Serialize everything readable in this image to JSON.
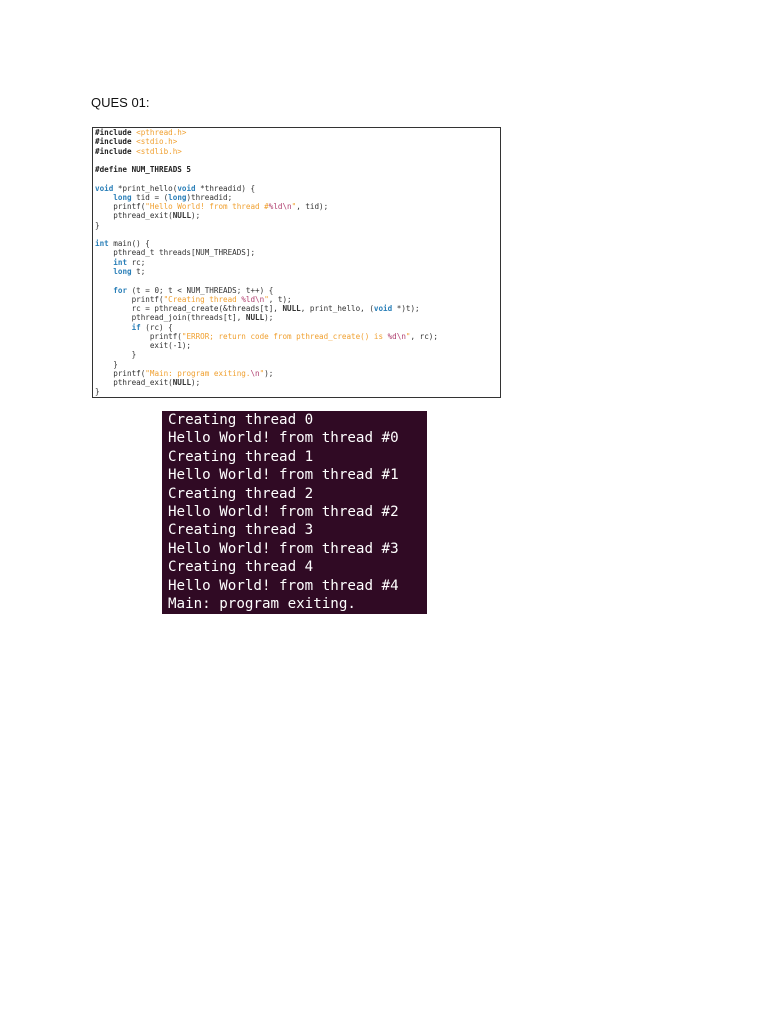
{
  "heading": "QUES 01:",
  "code_lines": [
    [
      [
        "#include ",
        "pp"
      ],
      [
        "<pthread.h>",
        "str"
      ]
    ],
    [
      [
        "#include ",
        "pp"
      ],
      [
        "<stdio.h>",
        "str"
      ]
    ],
    [
      [
        "#include ",
        "pp"
      ],
      [
        "<stdlib.h>",
        "str"
      ]
    ],
    [
      [
        "",
        ""
      ]
    ],
    [
      [
        "#define NUM_THREADS 5",
        "pp"
      ]
    ],
    [
      [
        "",
        ""
      ]
    ],
    [
      [
        "void",
        "kw"
      ],
      [
        " *print_hello(",
        ""
      ],
      [
        "void",
        "kw"
      ],
      [
        " *threadid) {",
        ""
      ]
    ],
    [
      [
        "    ",
        ""
      ],
      [
        "long",
        "kw"
      ],
      [
        " tid = (",
        ""
      ],
      [
        "long",
        "kw"
      ],
      [
        ")threadid;",
        ""
      ]
    ],
    [
      [
        "    printf(",
        ""
      ],
      [
        "\"Hello World! from thread #",
        "str"
      ],
      [
        "%ld",
        "esc"
      ],
      [
        "\\n",
        "esc"
      ],
      [
        "\"",
        "str"
      ],
      [
        ", tid);",
        ""
      ]
    ],
    [
      [
        "    pthread_exit(",
        ""
      ],
      [
        "NULL",
        "nul"
      ],
      [
        ");",
        ""
      ]
    ],
    [
      [
        "}",
        ""
      ]
    ],
    [
      [
        "",
        ""
      ]
    ],
    [
      [
        "int",
        "kw"
      ],
      [
        " main() {",
        ""
      ]
    ],
    [
      [
        "    pthread_t threads[NUM_THREADS];",
        ""
      ]
    ],
    [
      [
        "    ",
        ""
      ],
      [
        "int",
        "kw"
      ],
      [
        " rc;",
        ""
      ]
    ],
    [
      [
        "    ",
        ""
      ],
      [
        "long",
        "kw"
      ],
      [
        " t;",
        ""
      ]
    ],
    [
      [
        "",
        ""
      ]
    ],
    [
      [
        "    ",
        ""
      ],
      [
        "for",
        "kw"
      ],
      [
        " (t = 0; t < NUM_THREADS; t++) {",
        ""
      ]
    ],
    [
      [
        "        printf(",
        ""
      ],
      [
        "\"Creating thread ",
        "str"
      ],
      [
        "%ld",
        "esc"
      ],
      [
        "\\n",
        "esc"
      ],
      [
        "\"",
        "str"
      ],
      [
        ", t);",
        ""
      ]
    ],
    [
      [
        "        rc = pthread_create(&threads[t], ",
        ""
      ],
      [
        "NULL",
        "nul"
      ],
      [
        ", print_hello, (",
        ""
      ],
      [
        "void",
        "kw"
      ],
      [
        " *)t);",
        ""
      ]
    ],
    [
      [
        "        pthread_join(threads[t], ",
        ""
      ],
      [
        "NULL",
        "nul"
      ],
      [
        ");",
        ""
      ]
    ],
    [
      [
        "        ",
        ""
      ],
      [
        "if",
        "kw"
      ],
      [
        " (rc) {",
        ""
      ]
    ],
    [
      [
        "            printf(",
        ""
      ],
      [
        "\"ERROR; return code from pthread_create() is ",
        "str"
      ],
      [
        "%d",
        "esc"
      ],
      [
        "\\n",
        "esc"
      ],
      [
        "\"",
        "str"
      ],
      [
        ", rc);",
        ""
      ]
    ],
    [
      [
        "            exit(-1);",
        ""
      ]
    ],
    [
      [
        "        }",
        ""
      ]
    ],
    [
      [
        "    }",
        ""
      ]
    ],
    [
      [
        "    printf(",
        ""
      ],
      [
        "\"Main: program exiting.",
        "str"
      ],
      [
        "\\n",
        "esc"
      ],
      [
        "\"",
        "str"
      ],
      [
        ");",
        ""
      ]
    ],
    [
      [
        "    pthread_exit(",
        ""
      ],
      [
        "NULL",
        "nul"
      ],
      [
        ");",
        ""
      ]
    ],
    [
      [
        "}",
        ""
      ]
    ]
  ],
  "terminal_lines": [
    "Creating thread 0",
    "Hello World! from thread #0",
    "Creating thread 1",
    "Hello World! from thread #1",
    "Creating thread 2",
    "Hello World! from thread #2",
    "Creating thread 3",
    "Hello World! from thread #3",
    "Creating thread 4",
    "Hello World! from thread #4",
    "Main: program exiting."
  ]
}
